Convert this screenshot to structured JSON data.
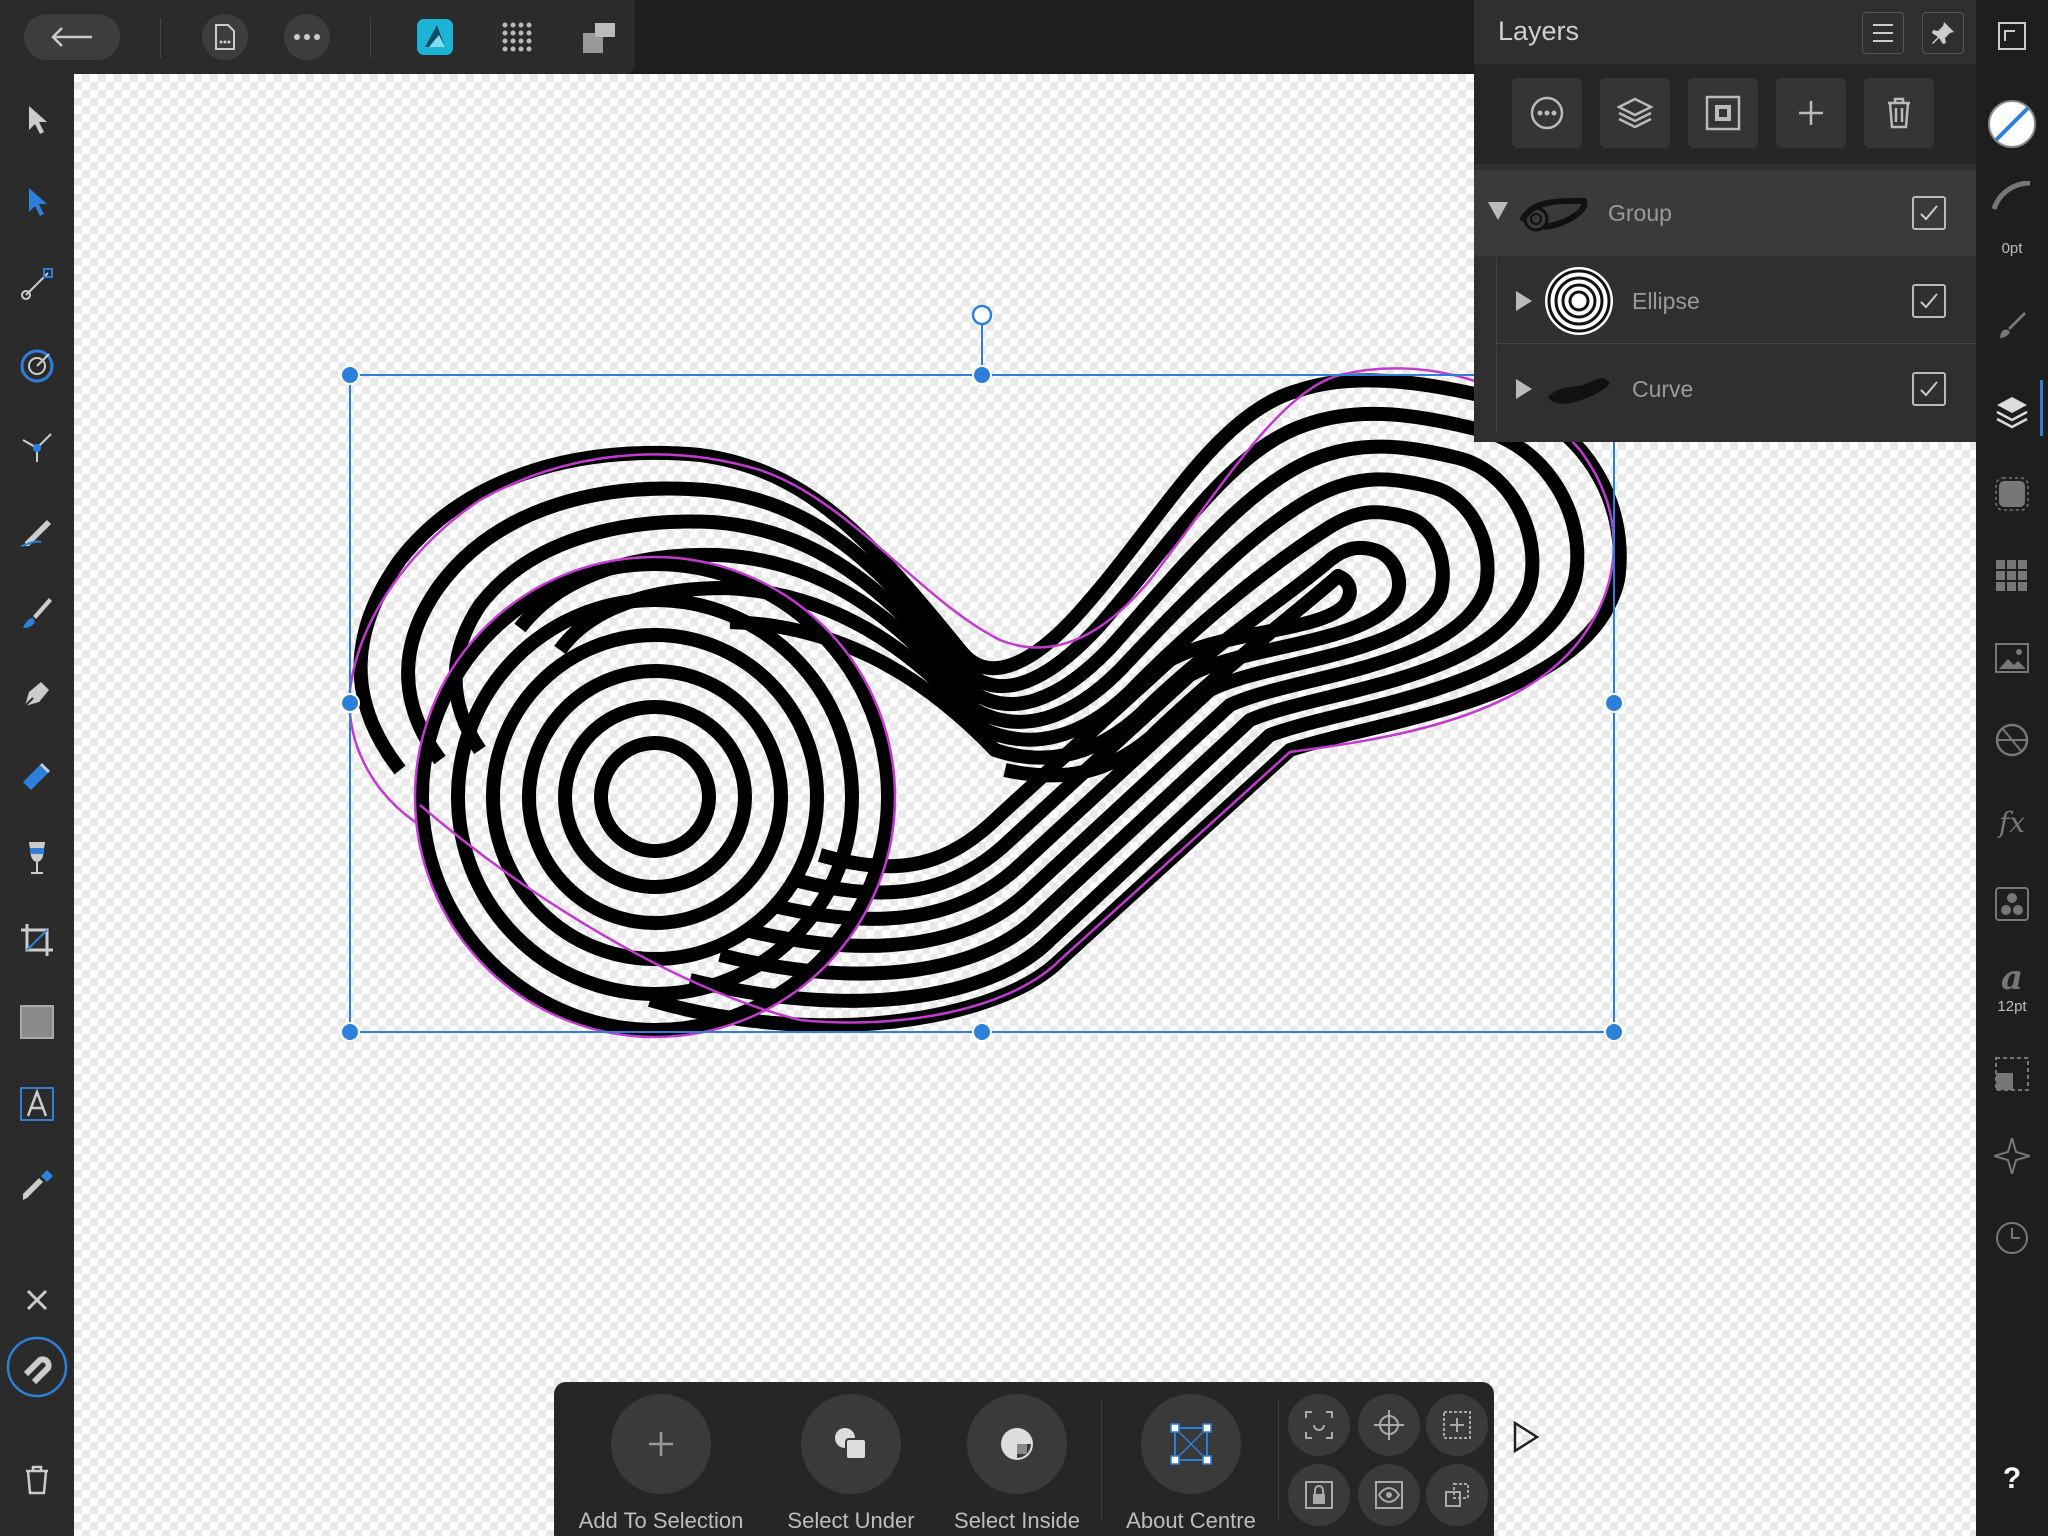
{
  "layers_panel": {
    "title": "Layers",
    "items": [
      {
        "name": "Group",
        "visible": true,
        "expanded": true
      },
      {
        "name": "Ellipse",
        "visible": true,
        "expanded": false
      },
      {
        "name": "Curve",
        "visible": true,
        "expanded": false
      }
    ]
  },
  "right_studio": {
    "stroke_width_label": "0pt",
    "font_size_label": "12pt",
    "help_label": "?"
  },
  "context_toolbar": {
    "add_to_selection": "Add To Selection",
    "select_under": "Select Under",
    "select_inside": "Select Inside",
    "about_centre": "About Centre"
  },
  "colors": {
    "selection": "#2e7fd9",
    "path_highlight": "#c33ad0",
    "app_brand": "#1cb3d6"
  },
  "icons": {
    "back": "arrow-left-icon",
    "document": "document-icon",
    "more": "more-icon",
    "persona": "designer-persona-icon",
    "grid": "grid-icon",
    "arrange": "arrange-icon"
  }
}
